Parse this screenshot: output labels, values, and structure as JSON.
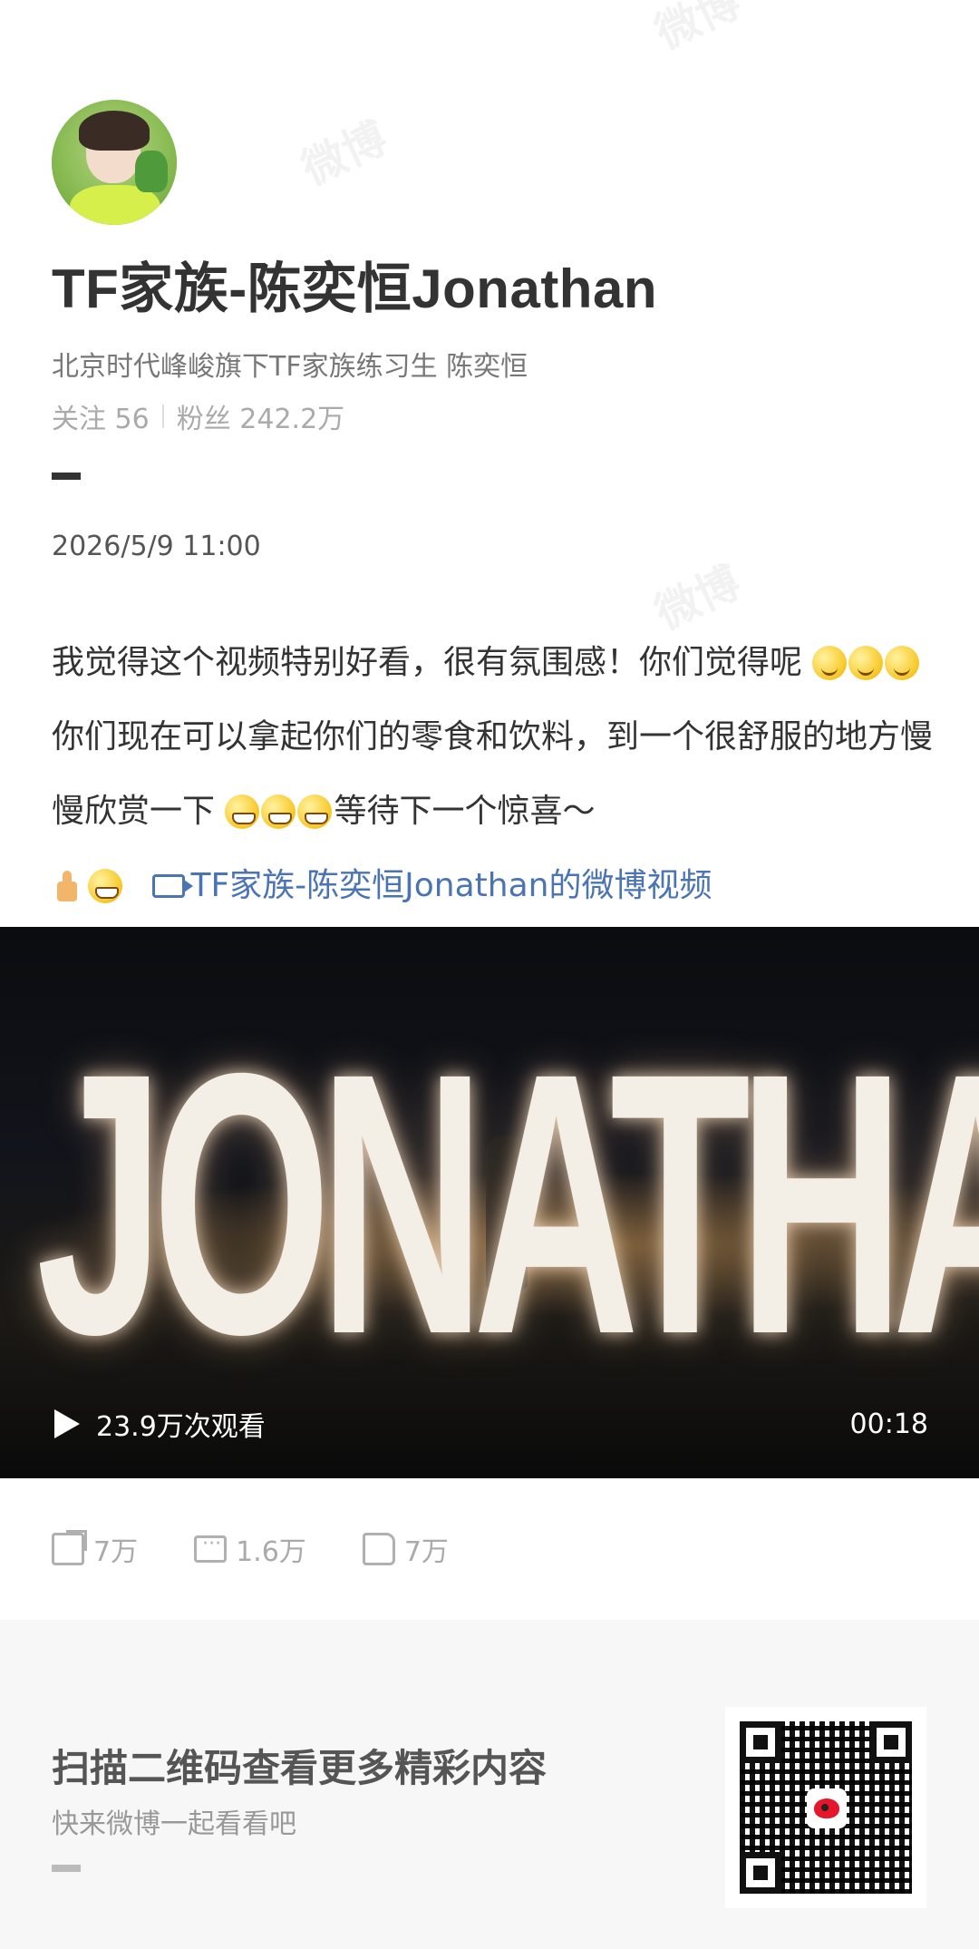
{
  "profile": {
    "name": "TF家族-陈奕恒Jonathan",
    "bio": "北京时代峰峻旗下TF家族练习生 陈奕恒",
    "following_label": "关注",
    "following_count": "56",
    "followers_label": "粉丝",
    "followers_count": "242.2万"
  },
  "post": {
    "datetime": "2026/5/9 11:00",
    "text_1": "我觉得这个视频特别好看，很有氛围感！你们觉得呢",
    "text_2": "你们现在可以拿起你们的零食和饮料，到一个很舒服的地方慢慢欣赏一下",
    "text_3": "等待下一个惊喜～",
    "video_link_text": "TF家族-陈奕恒Jonathan的微博视频"
  },
  "video": {
    "title_art": "JONATHAN",
    "views": "23.9万次观看",
    "duration": "00:18"
  },
  "actions": {
    "share_count": "7万",
    "comment_count": "1.6万",
    "like_count": "7万"
  },
  "footer": {
    "title": "扫描二维码查看更多精彩内容",
    "subtitle": "快来微博一起看看吧"
  },
  "watermark": "微博",
  "icons": [
    "share-icon",
    "comment-icon",
    "like-icon",
    "play-icon",
    "video-camera-icon",
    "qr-code-icon",
    "weibo-logo-icon"
  ],
  "colors": {
    "link": "#4a74b4",
    "text": "#333333",
    "muted": "#aaaaaa",
    "footer_bg": "#f7f7f7"
  }
}
